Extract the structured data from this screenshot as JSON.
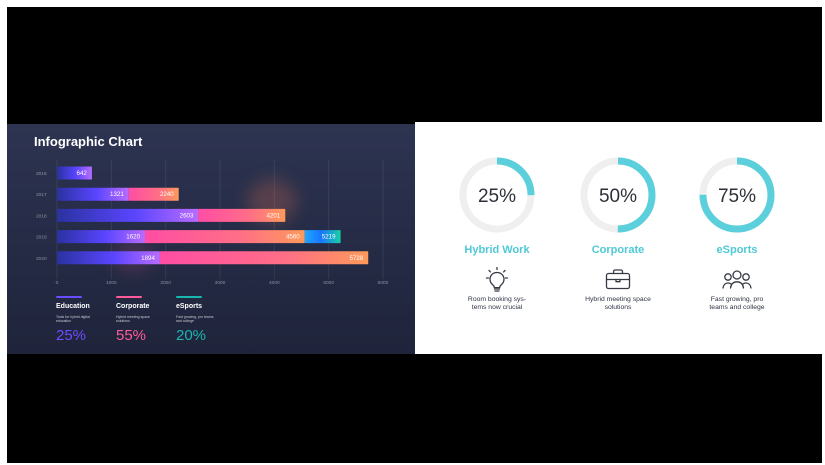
{
  "colors": {
    "page_bg": "#ffffff",
    "letterbox": "#000000",
    "left_panel": "#29304a",
    "right_panel": "#ffffff",
    "education": "#6a4cff",
    "corporate": "#ff5a98",
    "esports": "#19b6b0",
    "ring_track": "#efefef",
    "ring_fill": "#5bcfdc",
    "accent_text": "#4ec9d6"
  },
  "left_panel": {
    "title": "Infographic Chart",
    "legend": [
      {
        "name": "Education",
        "description": "Tools for hybrid digital education",
        "percent": "25%",
        "color": "#6a4cff"
      },
      {
        "name": "Corporate",
        "description": "Hybrid meeting space solutions",
        "percent": "55%",
        "color": "#ff5a98"
      },
      {
        "name": "eSports",
        "description": "Fast growing, pro teams and college",
        "percent": "20%",
        "color": "#19b6b0"
      }
    ]
  },
  "chart_data": {
    "type": "bar",
    "orientation": "horizontal",
    "stacked": true,
    "title": "Infographic Chart",
    "xlabel": "",
    "ylabel": "",
    "xlim": [
      0,
      6000
    ],
    "x_ticks": [
      "0",
      "1000",
      "2000",
      "3000",
      "4000",
      "5000",
      "6000"
    ],
    "categories": [
      "2016",
      "2017",
      "2018",
      "2019",
      "2020"
    ],
    "series": [
      {
        "name": "Education",
        "color": "#6a4cff",
        "values": [
          642,
          1321,
          2603,
          1620,
          1894
        ]
      },
      {
        "name": "Corporate",
        "color": "#ff5a98",
        "values": [
          0,
          2240,
          4201,
          4560,
          5728
        ]
      },
      {
        "name": "eSports",
        "color": "#19b6b0",
        "values": [
          0,
          0,
          0,
          5219,
          5728
        ]
      }
    ],
    "bar_labels": [
      [
        "642"
      ],
      [
        "1321",
        "2240"
      ],
      [
        "2603",
        "4201"
      ],
      [
        "1620",
        "4560",
        "5219"
      ],
      [
        "1894",
        "5728"
      ]
    ],
    "grid": true,
    "legend_position": "bottom-left"
  },
  "right_panel": {
    "stats": [
      {
        "percent": "25%",
        "value": 25,
        "title": "Hybrid Work",
        "description": "Room booking sys-\ntems now crucial",
        "icon": "lightbulb-icon"
      },
      {
        "percent": "50%",
        "value": 50,
        "title": "Corporate",
        "description": "Hybrid meeting space\nsolutions",
        "icon": "briefcase-icon"
      },
      {
        "percent": "75%",
        "value": 75,
        "title": "eSports",
        "description": "Fast growing, pro\nteams and college",
        "icon": "users-icon"
      }
    ]
  }
}
